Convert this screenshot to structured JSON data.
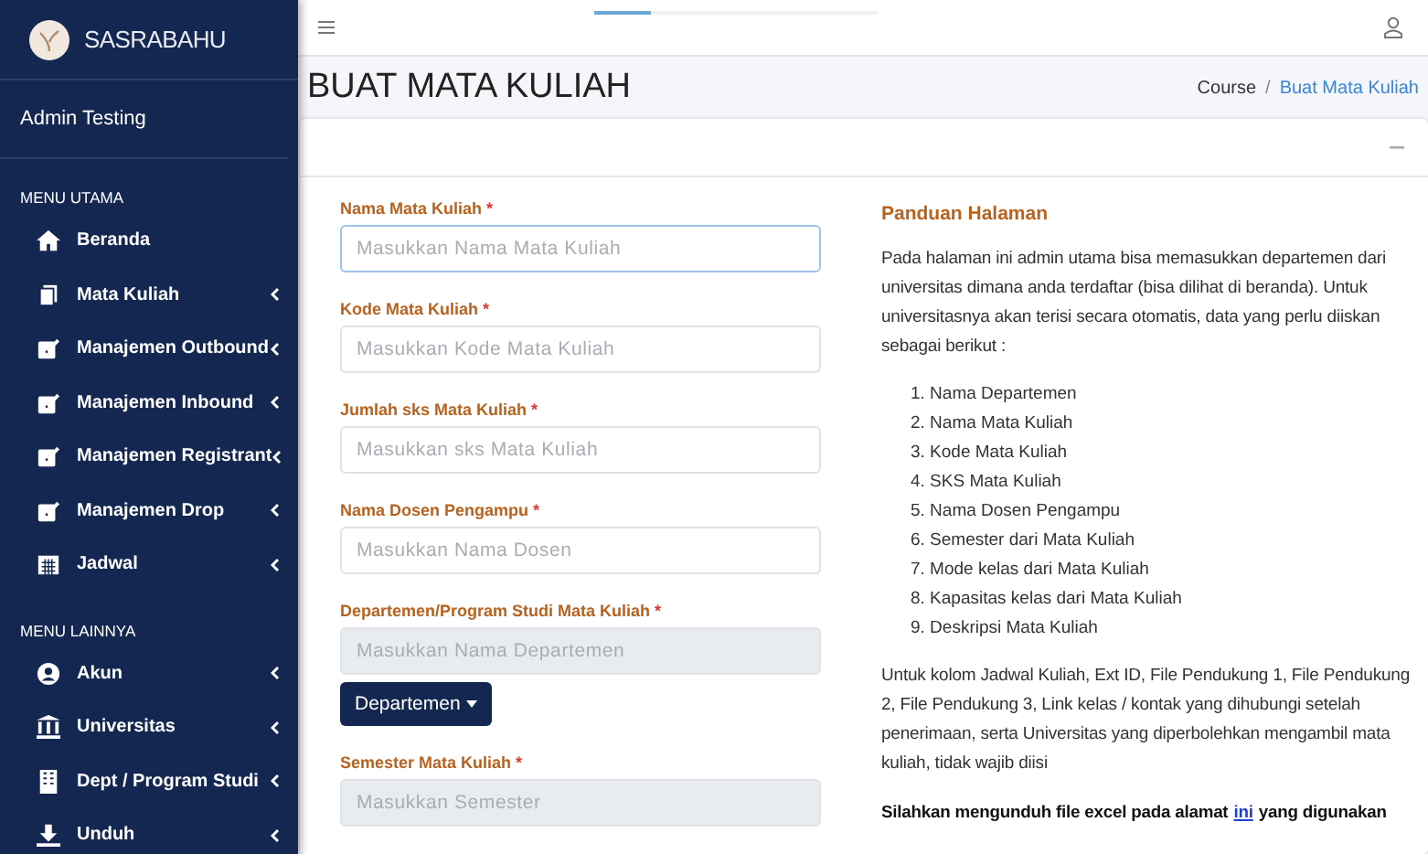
{
  "brand": {
    "name": "SASRABAHU"
  },
  "user": {
    "name": "Admin Testing"
  },
  "top_progress": {
    "level": 0.2
  },
  "menu_sections": [
    {
      "title": "MENU UTAMA",
      "items": [
        {
          "label": "Beranda",
          "submenu": false
        },
        {
          "label": "Mata Kuliah",
          "submenu": true
        },
        {
          "label": "Manajemen Outbound",
          "submenu": true
        },
        {
          "label": "Manajemen Inbound",
          "submenu": true
        },
        {
          "label": "Manajemen Registrant",
          "submenu": true
        },
        {
          "label": "Manajemen Drop",
          "submenu": true
        },
        {
          "label": "Jadwal",
          "submenu": true
        }
      ]
    },
    {
      "title": "MENU LAINNYA",
      "items": [
        {
          "label": "Akun",
          "submenu": true
        },
        {
          "label": "Universitas",
          "submenu": true
        },
        {
          "label": "Dept / Program Studi",
          "submenu": true
        },
        {
          "label": "Unduh",
          "submenu": true
        }
      ]
    }
  ],
  "page_title": "BUAT MATA KULIAH",
  "breadcrumb": [
    {
      "label": "Course",
      "current": false
    },
    {
      "label": "/",
      "kind": "sep"
    },
    {
      "label": "Buat Mata Kuliah",
      "current": true
    }
  ],
  "fields": [
    {
      "label": "Nama Mata Kuliah",
      "required": "*",
      "placeholder": "Masukkan Nama Mata Kuliah",
      "disabled": false,
      "focused": true
    },
    {
      "label": "Kode Mata Kuliah",
      "required": "*",
      "placeholder": "Masukkan Kode Mata Kuliah",
      "disabled": false,
      "focused": false
    },
    {
      "label": "Jumlah sks Mata Kuliah",
      "required": "*",
      "placeholder": "Masukkan sks Mata Kuliah",
      "disabled": false,
      "focused": false
    },
    {
      "label": "Nama Dosen Pengampu",
      "required": "*",
      "placeholder": "Masukkan Nama Dosen",
      "disabled": false,
      "focused": false
    },
    {
      "label": "Departemen/Program Studi Mata Kuliah",
      "required": "*",
      "placeholder": "Masukkan Nama Departemen",
      "disabled": true,
      "focused": false,
      "button": "Departemen"
    },
    {
      "label": "Semester Mata Kuliah",
      "required": "*",
      "placeholder": "Masukkan Semester",
      "disabled": true,
      "focused": false
    }
  ],
  "guide": {
    "title": "Panduan Halaman",
    "intro": "Pada halaman ini admin utama bisa memasukkan departemen dari universitas dimana anda terdaftar (bisa dilihat di beranda). Untuk universitasnya akan terisi secara otomatis, data yang perlu diiskan sebagai berikut :",
    "list": [
      {
        "num": "1.",
        "text": "Nama Departemen"
      },
      {
        "num": "2.",
        "text": "Nama Mata Kuliah"
      },
      {
        "num": "3.",
        "text": "Kode Mata Kuliah"
      },
      {
        "num": "4.",
        "text": "SKS Mata Kuliah"
      },
      {
        "num": "5.",
        "text": "Nama Dosen Pengampu"
      },
      {
        "num": "6.",
        "text": "Semester dari Mata Kuliah"
      },
      {
        "num": "7.",
        "text": "Mode kelas dari Mata Kuliah"
      },
      {
        "num": "8.",
        "text": "Kapasitas kelas dari Mata Kuliah"
      },
      {
        "num": "9.",
        "text": "Deskripsi Mata Kuliah"
      }
    ],
    "note": "Untuk kolom Jadwal Kuliah, Ext ID, File Pendukung 1, File Pendukung 2, File Pendukung 3, Link kelas / kontak yang dihubungi setelah penerimaan, serta Universitas yang diperbolehkan mengambil mata kuliah, tidak wajib diisi",
    "download": {
      "before": "Silahkan mengunduh file excel pada alamat",
      "link": "ini",
      "after": "yang digunakan"
    }
  }
}
